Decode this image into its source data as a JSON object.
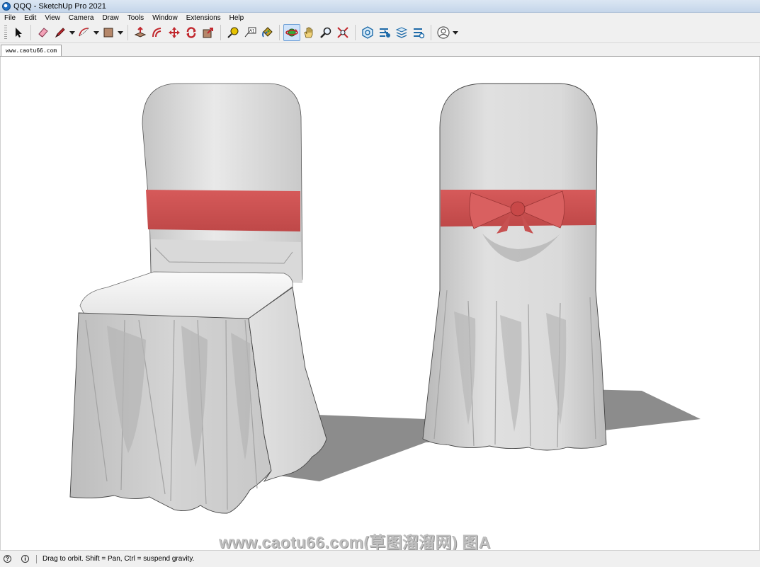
{
  "window": {
    "title": "QQQ - SketchUp Pro 2021"
  },
  "menu": {
    "items": [
      "File",
      "Edit",
      "View",
      "Camera",
      "Draw",
      "Tools",
      "Window",
      "Extensions",
      "Help"
    ]
  },
  "toolbar": {
    "tools": [
      {
        "name": "select-tool-icon"
      },
      {
        "name": "eraser-tool-icon"
      },
      {
        "name": "line-tool-icon"
      },
      {
        "name": "arc-tool-icon"
      },
      {
        "name": "rectangle-tool-icon"
      },
      {
        "name": "push-pull-tool-icon"
      },
      {
        "name": "offset-tool-icon"
      },
      {
        "name": "move-tool-icon"
      },
      {
        "name": "rotate-tool-icon"
      },
      {
        "name": "scale-tool-icon"
      },
      {
        "name": "tape-measure-tool-icon"
      },
      {
        "name": "text-tool-icon"
      },
      {
        "name": "paint-bucket-tool-icon"
      },
      {
        "name": "orbit-tool-icon",
        "active": true
      },
      {
        "name": "pan-tool-icon"
      },
      {
        "name": "zoom-tool-icon"
      },
      {
        "name": "zoom-extents-tool-icon"
      },
      {
        "name": "warehouse-icon"
      },
      {
        "name": "extension-warehouse-icon"
      },
      {
        "name": "layout-send-icon"
      },
      {
        "name": "extension-manager-icon"
      },
      {
        "name": "account-icon"
      }
    ]
  },
  "tabs": {
    "scene": "www.caotu66.com"
  },
  "viewport": {
    "watermark": "www.caotu66.com(草图溜溜网) 图A",
    "colors": {
      "background": "#ffffff",
      "fabric": "#d6d6d6",
      "sash": "#c95050",
      "shadow": "#8c8c8c"
    }
  },
  "status": {
    "text": "Drag to orbit. Shift = Pan, Ctrl = suspend gravity."
  }
}
